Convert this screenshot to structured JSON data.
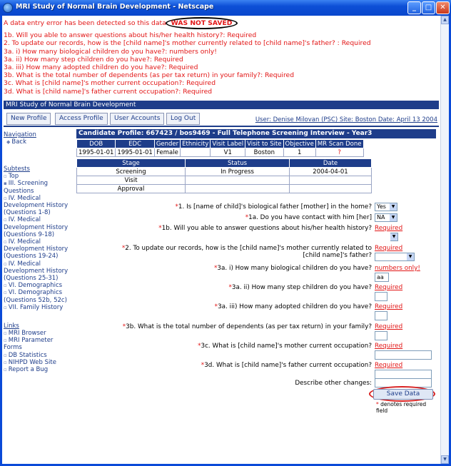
{
  "window": {
    "title": "MRI Study of Normal Brain Development - Netscape",
    "buttons": [
      "_",
      "□",
      "✕"
    ]
  },
  "error": {
    "intro": "A data entry error has been detected so this data",
    "not_saved": "WAS NOT SAVED",
    "lines": [
      "1b. Will you able to answer questions about his/her health history?: Required",
      "2. To update our records, how is the [child name]'s mother currently related to [child name]'s father? : Required",
      "3a. i) How many biological children do you have?: numbers only!",
      "3a. ii) How many step children do you have?: Required",
      "3a. iii) How many adopted children do you have?: Required",
      "3b. What is the total number of dependents (as per tax return) in your family?: Required",
      "3c. What is [child name]'s mother current occupation?: Required",
      "3d. What is [child name]'s father current occupation?: Required"
    ]
  },
  "app_title": "MRI Study of Normal Brain Development",
  "tabs": [
    "New Profile",
    "Access Profile",
    "User Accounts",
    "Log Out"
  ],
  "user_info": "User: Denise Milovan (PSC)  Site: Boston  Date: April 13 2004",
  "sidebar": {
    "navigation_head": "Navigation",
    "back": "Back",
    "subtests_head": "Subtests",
    "subtests": [
      "Top",
      "III. Screening Questions",
      "IV. Medical Development History (Questions 1-8)",
      "IV. Medical Development History (Questions 9-18)",
      "IV. Medical Development History (Questions 19-24)",
      "IV. Medical Development History (Questions 25-31)",
      "VI. Demographics",
      "VI. Demographics (Questions 52b, 52c)",
      "VII. Family History"
    ],
    "links_head": "Links",
    "links": [
      "MRI Browser",
      "MRI Parameter Forms",
      "DB Statistics",
      "NIHPD Web Site",
      "Report a Bug"
    ]
  },
  "profile": {
    "title": "Candidate Profile: 667423 / bos9469 - Full Telephone Screening Interview - Year3",
    "columns": [
      "DOB",
      "EDC",
      "Gender",
      "Ethnicity",
      "Visit Label",
      "Visit to Site",
      "Objective",
      "MR Scan Done"
    ],
    "row": [
      "1995-01-01",
      "1995-01-01",
      "Female",
      "",
      "V1",
      "Boston",
      "1",
      "?"
    ]
  },
  "status": {
    "columns": [
      "Stage",
      "Status",
      "Date"
    ],
    "rows": [
      [
        "Screening",
        "In Progress",
        "2004-04-01"
      ],
      [
        "Visit",
        "",
        ""
      ],
      [
        "Approval",
        "",
        ""
      ]
    ]
  },
  "form": {
    "q1": "1. Is [name of child]'s biological father [mother] in the home?",
    "q1_value": "Yes",
    "q1a": "1a. Do you have contact with him [her]",
    "q1a_value": "NA",
    "q1b": "1b. Will you able to answer questions about his/her health history?",
    "q2a": "2. To update our records, how is the [child name]'s mother currently related to",
    "q2b": "[child name]'s father?",
    "q3a1": "3a. i) How many biological children do you have?",
    "q3a1_value": "aa",
    "q3a2": "3a. ii) How many step children do you have?",
    "q3a3": "3a. iii) How many adopted children do you have?",
    "q3b": "3b. What is the total number of dependents (as per tax return) in your family?",
    "q3c": "3c. What is [child name]'s mother current occupation?",
    "q3d": "3d. What is [child name]'s father current occupation?",
    "other": "Describe other changes:",
    "required": "Required",
    "numbers_only": "numbers only!",
    "star": "*"
  },
  "save_label": "Save Data",
  "footnote": "denotes required field"
}
